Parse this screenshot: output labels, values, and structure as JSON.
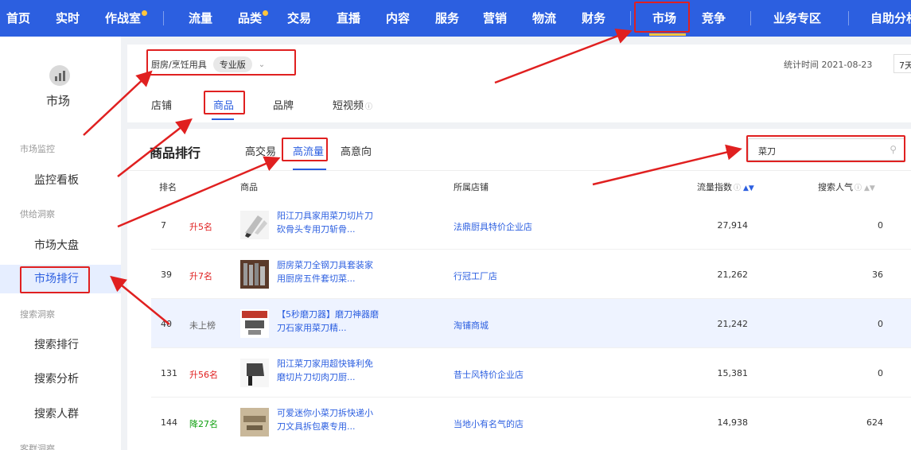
{
  "topnav": {
    "items": [
      "首页",
      "实时",
      "作战室",
      "流量",
      "品类",
      "交易",
      "直播",
      "内容",
      "服务",
      "营销",
      "物流",
      "财务",
      "市场",
      "竞争",
      "业务专区",
      "自助分析"
    ],
    "active": "市场",
    "accent": "#2c5fe0"
  },
  "sidebar": {
    "icon": "market-icon",
    "title": "市场",
    "groups": [
      {
        "label": "市场监控",
        "items": [
          "监控看板"
        ]
      },
      {
        "label": "供给洞察",
        "items": [
          "市场大盘",
          "市场排行"
        ]
      },
      {
        "label": "搜索洞察",
        "items": [
          "搜索排行",
          "搜索分析",
          "搜索人群"
        ]
      },
      {
        "label": "客群洞察",
        "items": []
      }
    ],
    "active_item": "市场排行"
  },
  "header": {
    "category": "厨房/烹饪用具",
    "edition": "专业版",
    "stat_time": "统计时间 2021-08-23",
    "range": "7天",
    "tabs": [
      "店铺",
      "商品",
      "品牌",
      "短视频"
    ],
    "active_tab": "商品"
  },
  "ranking": {
    "title": "商品排行",
    "subtabs": [
      "高交易",
      "高流量",
      "高意向"
    ],
    "active_subtab": "高流量",
    "search_value": "菜刀",
    "columns": {
      "rank": "排名",
      "product": "商品",
      "shop": "所属店铺",
      "flow": "流量指数",
      "popularity": "搜索人气"
    },
    "rows": [
      {
        "rank": "7",
        "change": "升5名",
        "change_type": "up",
        "name": "阳江刀具家用菜刀切片刀砍骨头专用刀斩骨...",
        "shop": "法鼎厨具特价企业店",
        "flow": "27,914",
        "popularity": "0"
      },
      {
        "rank": "39",
        "change": "升7名",
        "change_type": "up",
        "name": "厨房菜刀全钢刀具套装家用厨房五件套切菜...",
        "shop": "行冠工厂店",
        "flow": "21,262",
        "popularity": "36"
      },
      {
        "rank": "40",
        "change": "未上榜",
        "change_type": "none",
        "name": "【5秒磨刀器】磨刀神器磨刀石家用菜刀精...",
        "shop": "淘铺商城",
        "flow": "21,242",
        "popularity": "0"
      },
      {
        "rank": "131",
        "change": "升56名",
        "change_type": "up",
        "name": "阳江菜刀家用超快锋利免磨切片刀切肉刀厨...",
        "shop": "昔士风特价企业店",
        "flow": "15,381",
        "popularity": "0"
      },
      {
        "rank": "144",
        "change": "降27名",
        "change_type": "down",
        "name": "可爱迷你小菜刀拆快递小刀文具拆包裹专用...",
        "shop": "当地小有名气的店",
        "flow": "14,938",
        "popularity": "624"
      }
    ]
  },
  "annotation_color": "#e02020"
}
